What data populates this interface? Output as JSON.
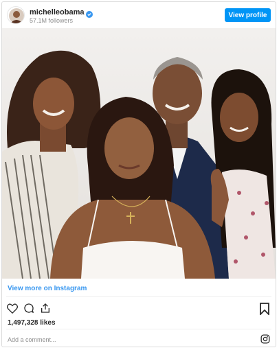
{
  "header": {
    "username": "michelleobama",
    "followers": "57.1M followers",
    "view_profile_label": "View profile"
  },
  "footer": {
    "view_more_label": "View more on Instagram",
    "likes": "1,497,328 likes",
    "comment_placeholder": "Add a comment..."
  },
  "icons": {
    "verified": "verified-badge-icon",
    "like": "heart-icon",
    "comment": "comment-icon",
    "share": "share-icon",
    "save": "bookmark-icon",
    "brand": "instagram-logo-icon"
  },
  "colors": {
    "accent": "#0095f6",
    "link": "#3897f0",
    "text": "#262626",
    "muted": "#8e8e8e",
    "border": "#dbdbdb"
  }
}
